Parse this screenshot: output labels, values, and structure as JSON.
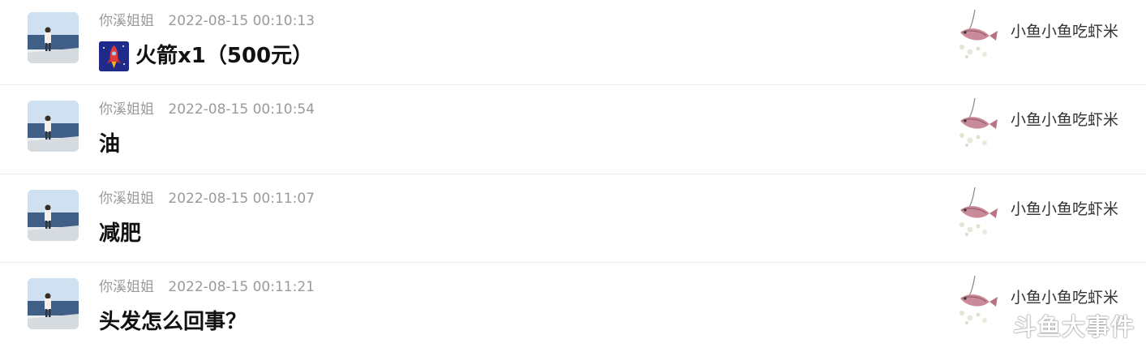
{
  "messages": [
    {
      "username": "你溪姐姐",
      "timestamp": "2022-08-15 00:10:13",
      "content": "火箭x1（500元）",
      "gift_icon": "rocket-icon",
      "recipient": "小鱼小鱼吃虾米"
    },
    {
      "username": "你溪姐姐",
      "timestamp": "2022-08-15 00:10:54",
      "content": "油",
      "recipient": "小鱼小鱼吃虾米"
    },
    {
      "username": "你溪姐姐",
      "timestamp": "2022-08-15 00:11:07",
      "content": "减肥",
      "recipient": "小鱼小鱼吃虾米"
    },
    {
      "username": "你溪姐姐",
      "timestamp": "2022-08-15 00:11:21",
      "content": "头发怎么回事？",
      "recipient": "小鱼小鱼吃虾米"
    }
  ],
  "watermark": "斗鱼大事件",
  "colors": {
    "meta_text": "#9a9a9a",
    "content_text": "#111111",
    "divider": "#ececec"
  }
}
